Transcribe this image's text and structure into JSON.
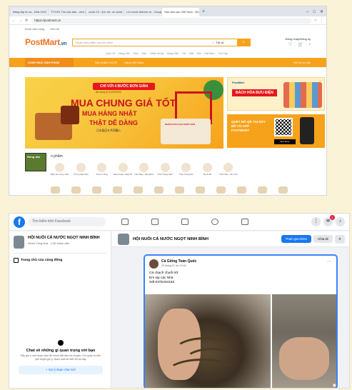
{
  "browser": {
    "tabs": [
      "Bảng tập từ ca - Nhà Chổi",
      "TTXVN Tìm của bảo - nhà Chổi",
      "covid 19 - lịch sử, vé covid 19",
      "Lời covid vitamin vs - Google",
      "Sàn dấu sao Việt Nam - Buy it"
    ],
    "active_tab_index": 4,
    "url": "https://postmart.vn"
  },
  "postmart": {
    "top_links": [
      "Kênh bán hàng",
      "Liên hệ"
    ],
    "logo_main": "PostMart",
    "logo_tld": ".vn",
    "search_placeholder": "Nhập sản phẩm cần tìm kiếm",
    "search_category": "Tất cả",
    "login_label": "Đăng nhập/Đăng ký",
    "cart_count": "0",
    "wishlist_count": "0",
    "keywords": [
      "Quà Tết",
      "Hàng Việt",
      "Sữa",
      "Gạo",
      "Nhãn Hưng",
      "Nông Sản",
      "Trà",
      "Mật",
      "Bột",
      "Hạt Điều",
      "Trái Cây"
    ],
    "nav_menu_label": "DANH MỤC SẢN PHẨM",
    "nav_links": [
      "Sản phẩm OCOP",
      "Hàng Việt Nam"
    ],
    "nav_right": "Hỗ trợ tư vấn",
    "banner": {
      "ribbon": "CHỈ VỚI 4 BƯỚC ĐƠN GIẢN",
      "date": "Áp dụng từ 01/03/2022",
      "title": "MUA CHUNG GIÁ TỐT",
      "sub1": "MUA HÀNG NHẬT",
      "sub2": "THẬT DỄ DÀNG",
      "jp": "日本製品を共同購入",
      "rice_label": "NHẬP KHẨU GẠO NHẬT BẢN"
    },
    "side_banner1": {
      "logo": "PostMart",
      "title": "BÁCH HÓA BƯU ĐIỆN"
    },
    "side_banner2": {
      "text": "QUÉT MÃ QR TẠI ĐÂY ĐỂ TẢI APP POSTMART",
      "store": "App Store"
    },
    "category_thumb_label": "Nông sản",
    "category_title": "n phẩm",
    "categories": [
      "Đặc sản vùng miền",
      "Thực phẩm khô",
      "Nước Uống",
      "Điện thoại - Điện tử",
      "Làm Đẹp - Mỹ phẩm",
      "Thời Trang Nam",
      "Thời Trang Nữ",
      "Mẹ & Bé",
      "Thể Thao - Du Lịch"
    ]
  },
  "facebook": {
    "search_placeholder": "Tìm kiếm trên Facebook",
    "notif_count": "2",
    "group_name": "HỘI NUÔI CÁ NƯỚC NGỌT NINH BÌNH",
    "group_privacy": "Nhóm Công khai",
    "group_members": "4,3K thành viên",
    "home_link": "Trang chủ của cộng đồng",
    "chat_title": "Chat về những gì quan trọng với bạn",
    "chat_desc": "Hãy gợi ý một đoạn chat để nhóm bắt đầu trò chuyện. Khi quản trị viên phê duyệt gợi ý, đoạn chat sẽ hiển thị tại đây.",
    "chat_button": "+ Gợi ý đoạn chat mới",
    "join_button": "Tham gia nhóm",
    "share_button": "Chia sẻ",
    "post": {
      "author": "Cá Giống Toàn Quốc",
      "time": "25 tháng 01 lúc 19:40",
      "lines": [
        "Cá chạch chuối trữ",
        "Em sip các Nhà",
        "Sđt 0375434163"
      ]
    }
  }
}
